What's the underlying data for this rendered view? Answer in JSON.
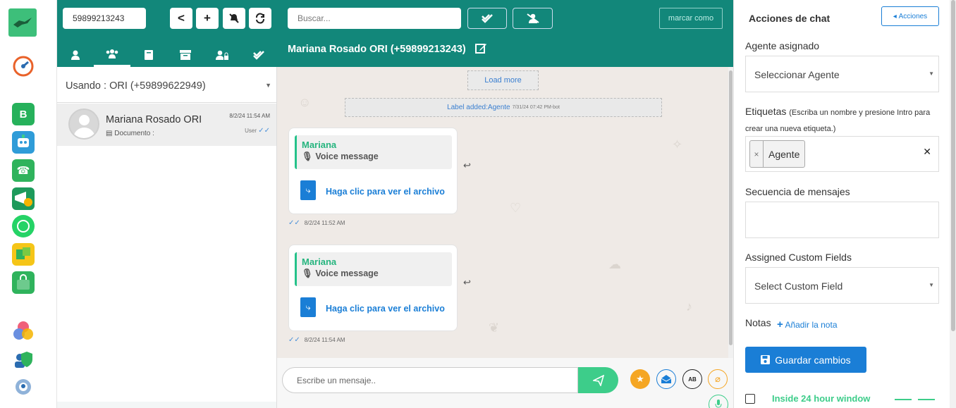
{
  "toolbar": {
    "phone_value": "59899213243",
    "search_placeholder": "Buscar...",
    "marcar_label": "marcar como",
    "back_symbol": "<",
    "add_symbol": "+"
  },
  "icons": {
    "bell_off": "bell-slash-icon",
    "refresh": "refresh-icon",
    "check_double": "check-double-icon",
    "user_slash": "user-slash-icon",
    "edit": "edit-icon",
    "send": "paper-plane-icon"
  },
  "colors": {
    "header": "#12877a",
    "accent_green": "#3dcd8a",
    "primary_blue": "#1a7ed6",
    "chat_bg": "#efeae6"
  },
  "contacts": {
    "usando": "Usando : ORI (+59899622949)",
    "items": [
      {
        "name": "Mariana Rosado ORI",
        "sub": "Documento :",
        "time": "8/2/24 11:54 AM",
        "user": "User"
      }
    ]
  },
  "chat": {
    "title": "Mariana Rosado ORI (+59899213243)",
    "load_more": "Load more",
    "label_added": "Label added:Agente",
    "label_meta": "7/31/24 07:42 PM-bot",
    "messages": [
      {
        "sender": "Mariana",
        "quoted": "Voice message",
        "file_text": "Haga clic para ver el archivo",
        "time": "8/2/24 11:52 AM"
      },
      {
        "sender": "Mariana",
        "quoted": "Voice message",
        "file_text": "Haga clic para ver el archivo",
        "time": "8/2/24 11:54 AM"
      }
    ],
    "composer_placeholder": "Escribe un mensaje..",
    "ab_badge": "AB"
  },
  "panel": {
    "title": "Acciones de chat",
    "acciones_btn": "Acciones",
    "agent_label": "Agente asignado",
    "agent_select": "Seleccionar Agente",
    "tags_label": "Etiquetas",
    "tags_hint": "(Escriba un nombre y presione Intro para crear una nueva etiqueta.)",
    "tags": [
      "Agente"
    ],
    "sequence_label": "Secuencia de mensajes",
    "custom_fields_label": "Assigned Custom Fields",
    "custom_field_select": "Select Custom Field",
    "notes_label": "Notas",
    "add_note": "Añadir la nota",
    "save_btn": "Guardar cambios",
    "inside_window": "Inside 24 hour window"
  }
}
